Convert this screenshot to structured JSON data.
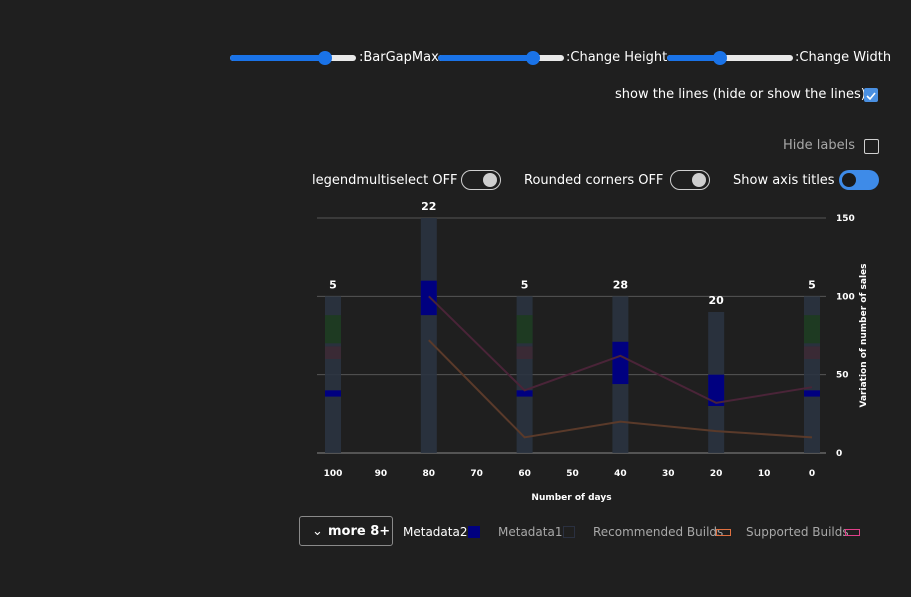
{
  "controls": {
    "bar_gap_max_label": ":BarGapMax",
    "change_height_label": ":Change Height",
    "change_width_label": ":Change Width",
    "bar_gap_max_value": 0.75,
    "change_height_value": 0.75,
    "change_width_value": 0.42,
    "show_lines_label": "show the lines (hide or show the lines)",
    "show_lines_checked": true,
    "hide_labels_label": "Hide labels",
    "hide_labels_checked": false,
    "legend_multiselect_label": "legendmultiselect OFF",
    "rounded_corners_label": "Rounded corners OFF",
    "show_axis_titles_label": "Show axis titles",
    "show_axis_titles_on": true
  },
  "legend": {
    "more_label": "more 8+",
    "items": [
      {
        "name": "Metadata2",
        "color": "#000080",
        "style": "filled",
        "active": true
      },
      {
        "name": "Metadata1",
        "color": "#2a3040",
        "style": "outline",
        "active": false
      },
      {
        "name": "Recommended Builds",
        "color": "#e07040",
        "style": "outline",
        "active": false
      },
      {
        "name": "Supported Builds",
        "color": "#e0408a",
        "style": "outline",
        "active": false
      }
    ]
  },
  "chart_data": {
    "type": "bar",
    "xlabel": "Number of days",
    "ylabel": "Variation of number of sales",
    "xlim": [
      100,
      0
    ],
    "ylim": [
      0,
      150
    ],
    "x_ticks": [
      "100",
      "90",
      "80",
      "70",
      "60",
      "50",
      "40",
      "30",
      "20",
      "10",
      "0"
    ],
    "y_ticks": [
      "0",
      "50",
      "100",
      "150"
    ],
    "grid": true,
    "y_axis_side": "right",
    "x": [
      100,
      80,
      60,
      40,
      20,
      0
    ],
    "bar_labels": [
      "5",
      "22",
      "5",
      "28",
      "20",
      "5"
    ],
    "series": [
      {
        "name": "Metadata1",
        "values": [
          100,
          150,
          100,
          100,
          90,
          100
        ]
      },
      {
        "name": "Metadata2",
        "ranges": [
          [
            36,
            40
          ],
          [
            88,
            110
          ],
          [
            36,
            40
          ],
          [
            44,
            71
          ],
          [
            30,
            50
          ],
          [
            36,
            40
          ]
        ]
      },
      {
        "name": "Recommended Builds",
        "values": [
          null,
          72,
          10,
          20,
          14,
          10
        ]
      },
      {
        "name": "Supported Builds",
        "values": [
          null,
          100,
          40,
          62,
          32,
          42
        ]
      }
    ]
  }
}
